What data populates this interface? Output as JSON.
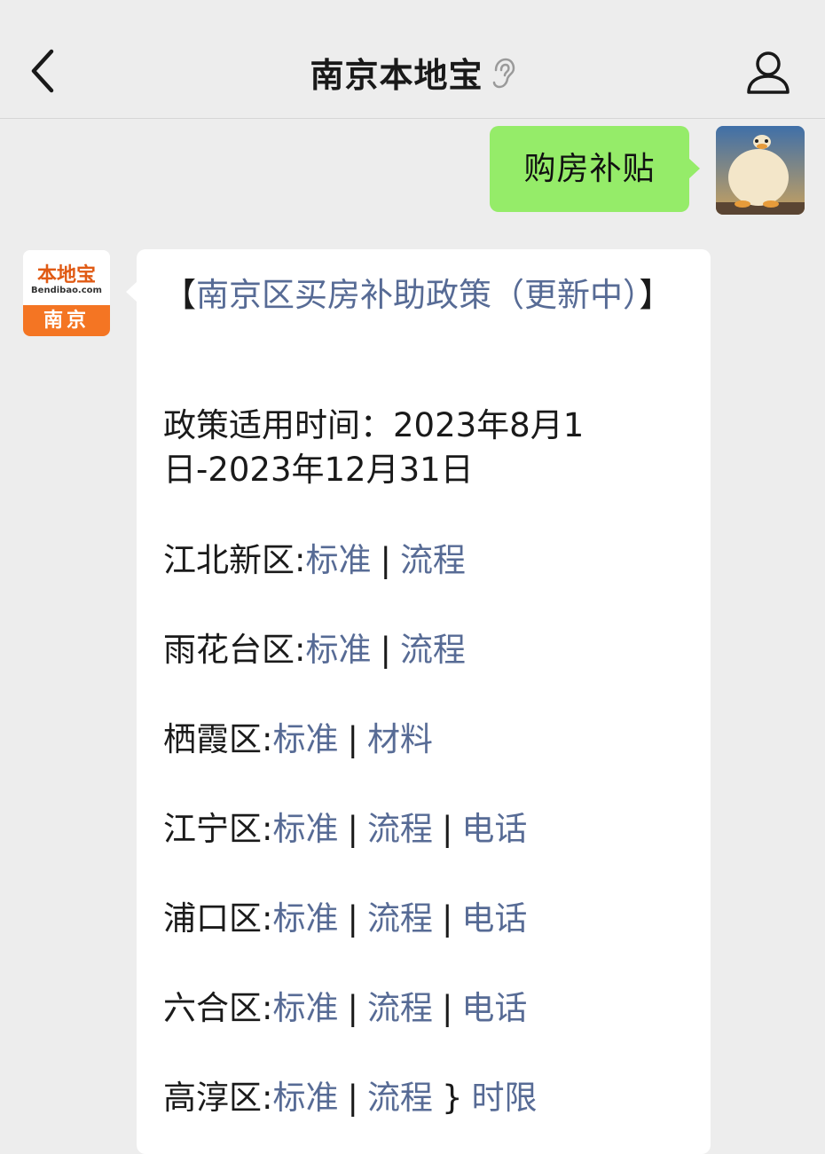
{
  "header": {
    "title": "南京本地宝"
  },
  "outgoing": {
    "text": "购房补贴"
  },
  "bot_avatar": {
    "brand": "本地宝",
    "url": "Bendibao.com",
    "city": "南京"
  },
  "reply": {
    "title_open": "【",
    "title_link": "南京区买房补助政策（更新中）",
    "title_close": "】",
    "time_label": "政策适用时间：",
    "time_value": "2023年8月1日-2023年12月31日",
    "districts": [
      {
        "name": "江北新区:",
        "links": [
          "标准",
          "流程"
        ],
        "seps": [
          "|"
        ]
      },
      {
        "name": "雨花台区:",
        "links": [
          "标准",
          "流程"
        ],
        "seps": [
          "|"
        ]
      },
      {
        "name": "栖霞区:",
        "links": [
          "标准",
          "材料"
        ],
        "seps": [
          "|"
        ]
      },
      {
        "name": "江宁区:",
        "links": [
          "标准",
          "流程",
          "电话"
        ],
        "seps": [
          "|",
          "|"
        ]
      },
      {
        "name": "浦口区:",
        "links": [
          "标准",
          "流程",
          "电话"
        ],
        "seps": [
          "|",
          "|"
        ]
      },
      {
        "name": "六合区:",
        "links": [
          "标准",
          "流程",
          "电话"
        ],
        "seps": [
          "|",
          "|"
        ]
      },
      {
        "name": "高淳区:",
        "links": [
          "标准",
          "流程",
          "时限"
        ],
        "seps": [
          "|",
          "}"
        ]
      }
    ]
  },
  "colors": {
    "background": "#ededed",
    "outgoing_bubble": "#95ec69",
    "link": "#576b95"
  }
}
